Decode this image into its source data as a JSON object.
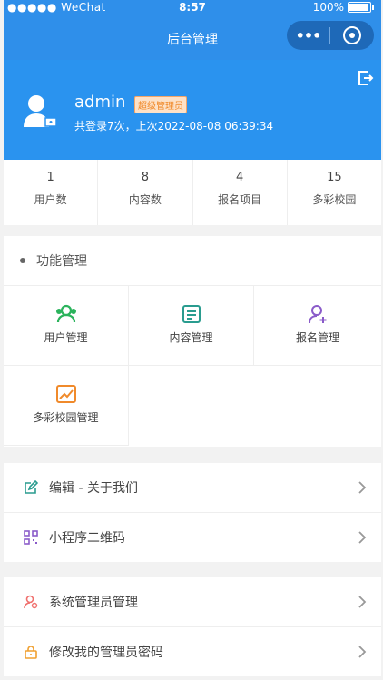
{
  "status": {
    "carrier": "●●●●● WeChat",
    "time": "8:57",
    "battery": "100%"
  },
  "nav": {
    "title": "后台管理"
  },
  "user": {
    "name": "admin",
    "role": "超级管理员",
    "login_info": "共登录7次，上次2022-08-08 06:39:34"
  },
  "stats": [
    {
      "value": "1",
      "label": "用户数"
    },
    {
      "value": "8",
      "label": "内容数"
    },
    {
      "value": "4",
      "label": "报名项目"
    },
    {
      "value": "15",
      "label": "多彩校园"
    }
  ],
  "functions": {
    "title": "功能管理",
    "items": [
      {
        "label": "用户管理",
        "icon": "users-icon"
      },
      {
        "label": "内容管理",
        "icon": "content-icon"
      },
      {
        "label": "报名管理",
        "icon": "user-add-icon"
      },
      {
        "label": "多彩校园管理",
        "icon": "chart-icon"
      }
    ]
  },
  "list1": [
    {
      "label": "编辑 - 关于我们",
      "icon": "edit-icon"
    },
    {
      "label": "小程序二维码",
      "icon": "qrcode-icon"
    }
  ],
  "list2": [
    {
      "label": "系统管理员管理",
      "icon": "admin-icon"
    },
    {
      "label": "修改我的管理员密码",
      "icon": "lock-icon"
    }
  ],
  "colors": {
    "primary": "#2a93ef",
    "green": "#2bb35c",
    "teal": "#2a9c8f",
    "purple": "#8a5bc9",
    "orange": "#f08a2b"
  }
}
